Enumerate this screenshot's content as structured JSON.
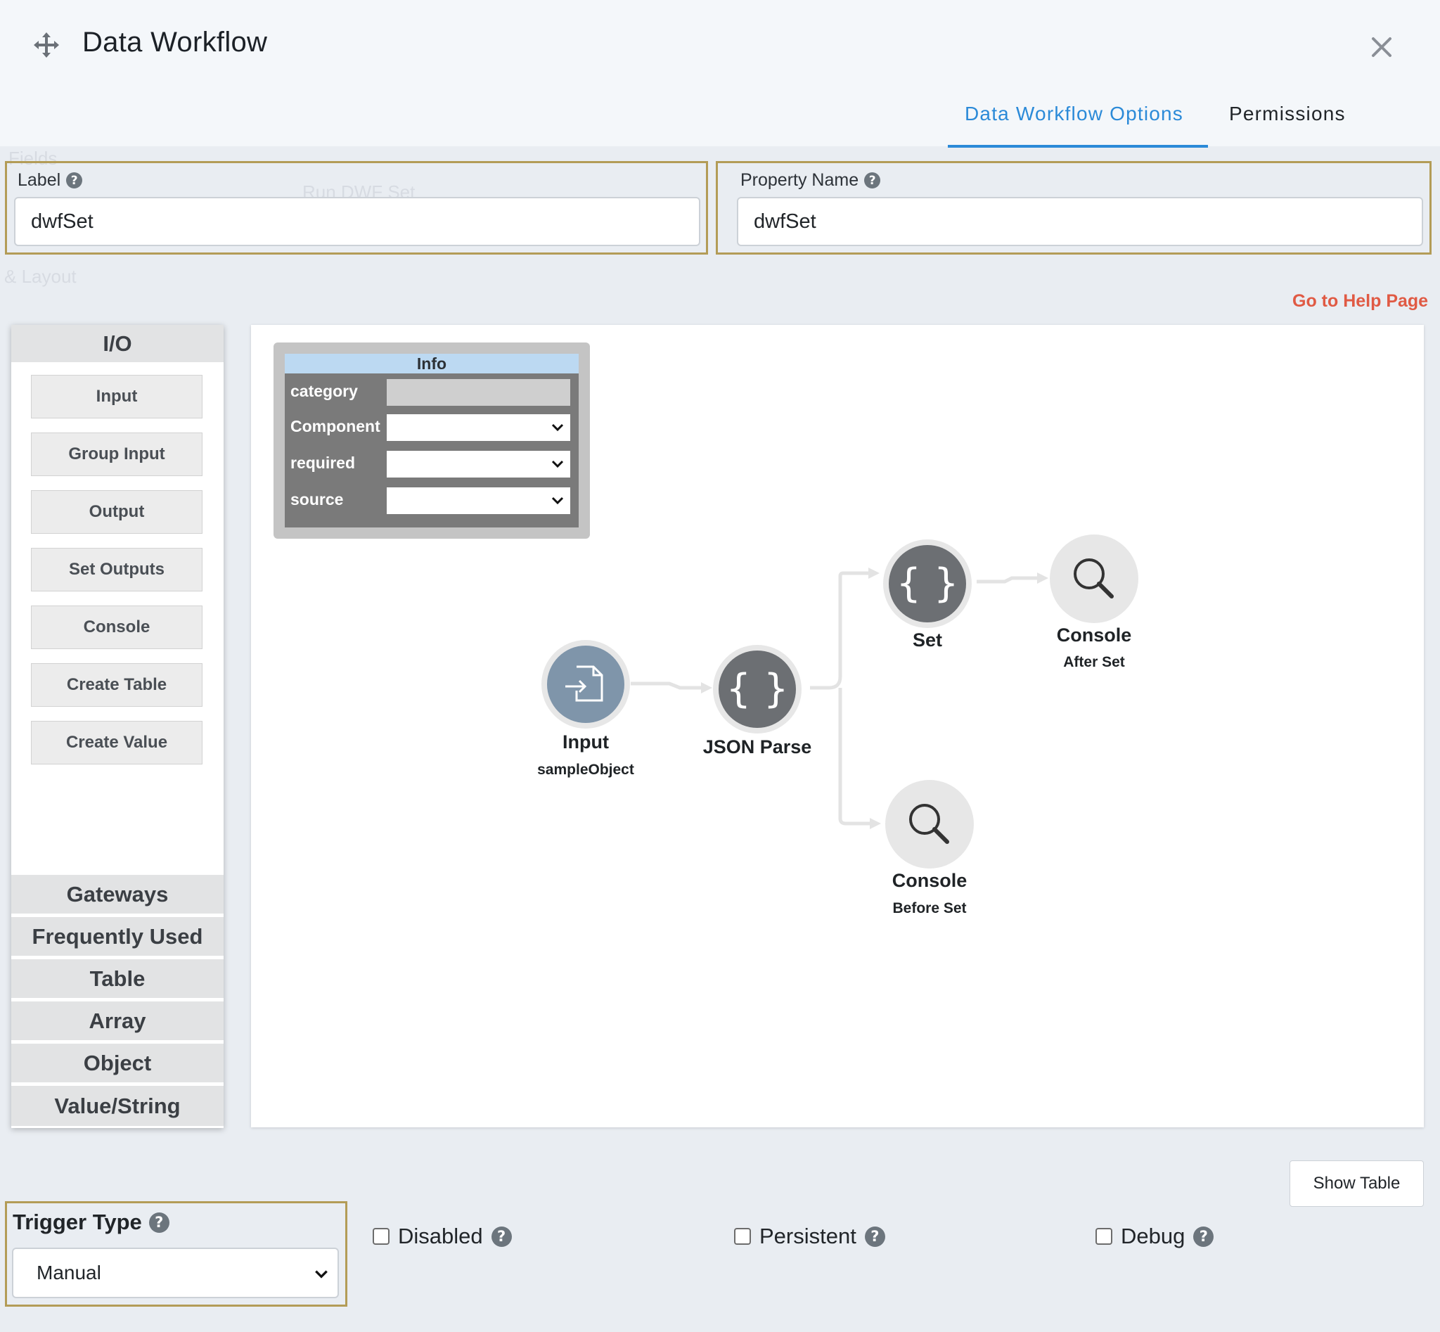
{
  "window": {
    "title": "Data Workflow"
  },
  "tabs": [
    {
      "label": "Data Workflow Options",
      "active": true
    },
    {
      "label": "Permissions",
      "active": false
    }
  ],
  "fields": {
    "label": {
      "caption": "Label",
      "value": "dwfSet"
    },
    "property_name": {
      "caption": "Property Name",
      "value": "dwfSet"
    }
  },
  "help_link": "Go to Help Page",
  "background_text": [
    "Fields",
    "Run DWF Set",
    "& Layout"
  ],
  "palette": {
    "open_section": "I/O",
    "items": [
      "Input",
      "Group Input",
      "Output",
      "Set Outputs",
      "Console",
      "Create Table",
      "Create Value"
    ],
    "sections": [
      "Gateways",
      "Frequently Used",
      "Table",
      "Array",
      "Object",
      "Value/String"
    ]
  },
  "info_panel": {
    "title": "Info",
    "rows": [
      {
        "key": "category",
        "type": "readonly"
      },
      {
        "key": "Component",
        "type": "select"
      },
      {
        "key": "required",
        "type": "select"
      },
      {
        "key": "source",
        "type": "select"
      }
    ]
  },
  "nodes": {
    "input": {
      "label": "Input",
      "sub": "sampleObject",
      "icon": "file-import-icon"
    },
    "json_parse": {
      "label": "JSON Parse",
      "icon": "curly-braces-icon"
    },
    "set": {
      "label": "Set",
      "icon": "curly-braces-icon"
    },
    "console_after": {
      "label": "Console",
      "sub": "After Set",
      "icon": "magnifier-icon"
    },
    "console_before": {
      "label": "Console",
      "sub": "Before Set",
      "icon": "magnifier-icon"
    }
  },
  "bottom": {
    "show_table": "Show Table",
    "trigger_type": {
      "label": "Trigger Type",
      "value": "Manual"
    },
    "checkboxes": [
      {
        "label": "Disabled",
        "checked": false
      },
      {
        "label": "Persistent",
        "checked": false
      },
      {
        "label": "Debug",
        "checked": false
      }
    ]
  },
  "colors": {
    "accent": "#2b8ad8",
    "help_link": "#e05a44",
    "field_border": "#b39c57",
    "node_dark": "#6c6f73",
    "node_input": "#7f95aa",
    "node_light": "#e7e7e7"
  }
}
